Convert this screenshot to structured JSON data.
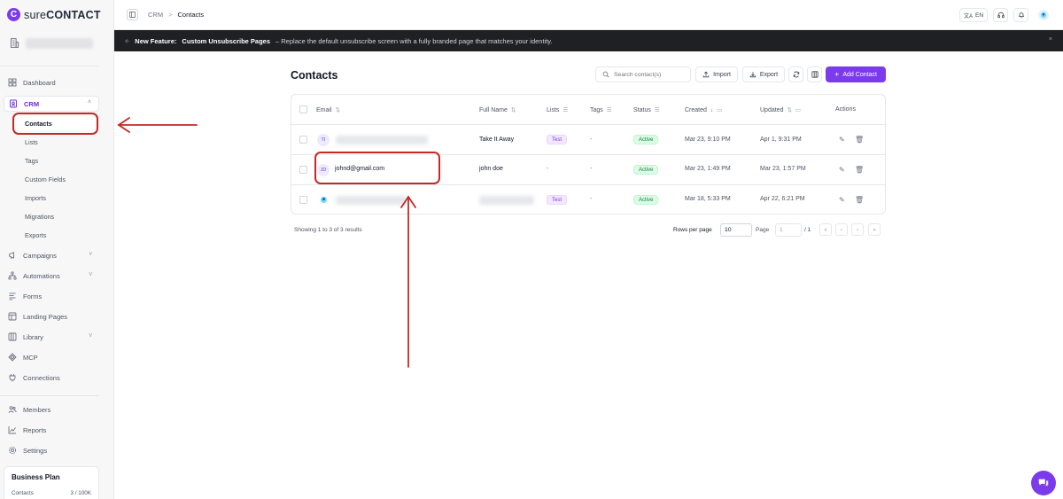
{
  "app": {
    "brand_prefix": "sure",
    "brand_suffix": "CONTACT",
    "logo_letter": "C"
  },
  "sidebar": {
    "items": [
      {
        "key": "dashboard",
        "label": "Dashboard"
      },
      {
        "key": "crm",
        "label": "CRM"
      },
      {
        "key": "campaigns",
        "label": "Campaigns"
      },
      {
        "key": "automations",
        "label": "Automations"
      },
      {
        "key": "forms",
        "label": "Forms"
      },
      {
        "key": "landing",
        "label": "Landing Pages"
      },
      {
        "key": "library",
        "label": "Library"
      },
      {
        "key": "mcp",
        "label": "MCP"
      },
      {
        "key": "connections",
        "label": "Connections"
      },
      {
        "key": "members",
        "label": "Members"
      },
      {
        "key": "reports",
        "label": "Reports"
      },
      {
        "key": "settings",
        "label": "Settings"
      }
    ],
    "crm_sub": [
      "Contacts",
      "Lists",
      "Tags",
      "Custom Fields",
      "Imports",
      "Migrations",
      "Exports"
    ],
    "plan": {
      "title": "Business Plan",
      "contacts_label": "Contacts",
      "contacts_value": "3 / 100K"
    }
  },
  "topbar": {
    "breadcrumb": [
      "CRM",
      "Contacts"
    ],
    "separator": ">",
    "lang": "EN"
  },
  "banner": {
    "prefix": "New Feature:",
    "title": "Custom Unsubscribe Pages",
    "text": "– Replace the default unsubscribe screen with a fully branded page that matches your identity.",
    "close": "×"
  },
  "main": {
    "title": "Contacts",
    "search_placeholder": "Search contact(s)",
    "import_label": "Import",
    "export_label": "Export",
    "add_label": "Add Contact",
    "columns": {
      "email": "Email",
      "full_name": "Full Name",
      "lists": "Lists",
      "tags": "Tags",
      "status": "Status",
      "created": "Created",
      "updated": "Updated",
      "actions": "Actions"
    },
    "rows": [
      {
        "initials": "TI",
        "email": "",
        "full_name": "Take It Away",
        "list": "Test",
        "tags": "-",
        "status": "Active",
        "created": "Mar 23, 9:10 PM",
        "updated": "Apr 1, 9:31 PM"
      },
      {
        "initials": "JD",
        "email": "johnd@gmail.com",
        "full_name": "john doe",
        "list": "-",
        "tags": "-",
        "status": "Active",
        "created": "Mar 23, 1:49 PM",
        "updated": "Mar 23, 1:57 PM"
      },
      {
        "initials": "",
        "email": "",
        "full_name": "",
        "list": "Test",
        "tags": "-",
        "status": "Active",
        "created": "Mar 18, 5:33 PM",
        "updated": "Apr 22, 6:21 PM"
      }
    ],
    "footer": {
      "results": "Showing 1 to 3 of 3 results",
      "rows_per_page_label": "Rows per page",
      "rows_per_page_value": "10",
      "page_label": "Page",
      "page_value": "1",
      "page_total": "/ 1"
    }
  },
  "colors": {
    "accent": "#7c3aed",
    "annotation": "#c62828",
    "active_badge": "#15803d"
  }
}
